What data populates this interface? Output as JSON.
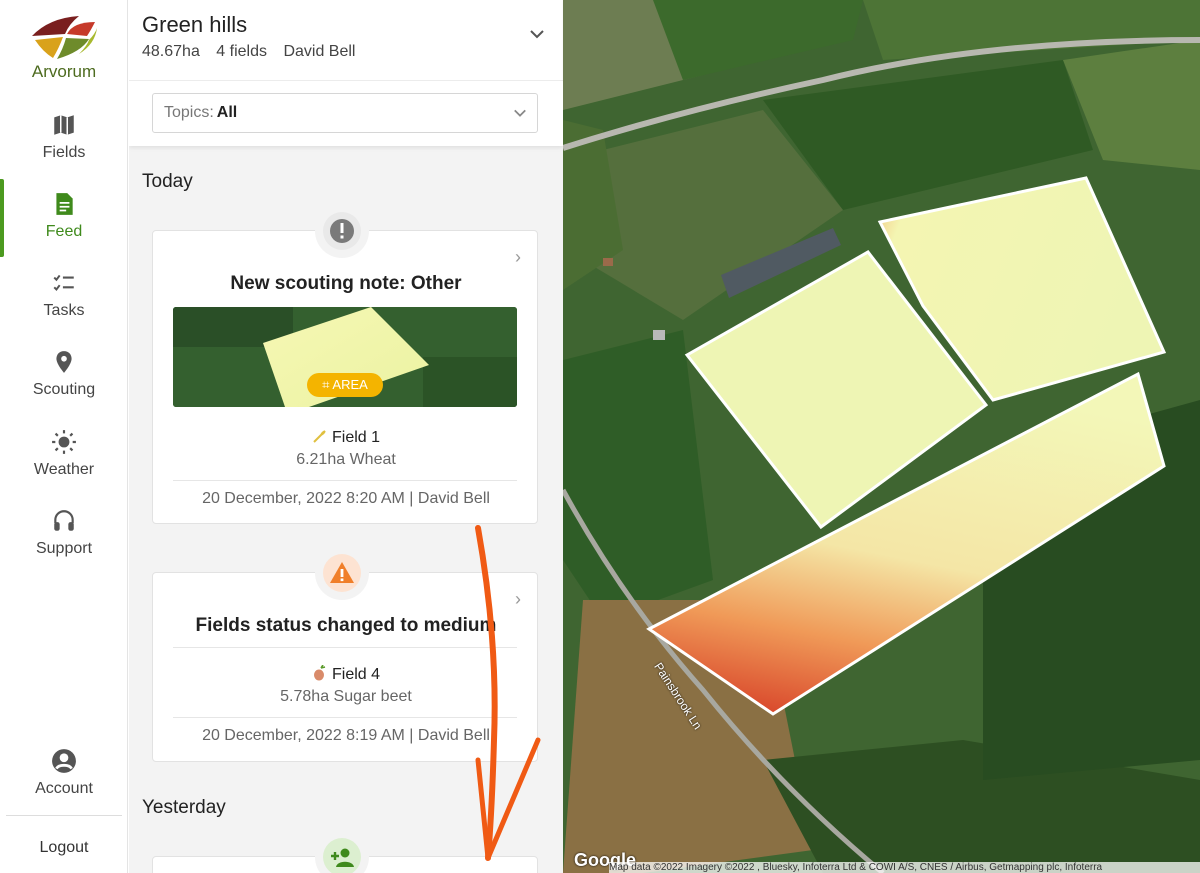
{
  "app": {
    "logo_text": "Arvorum"
  },
  "nav": {
    "fields": "Fields",
    "feed": "Feed",
    "tasks": "Tasks",
    "scouting": "Scouting",
    "weather": "Weather",
    "support": "Support",
    "account": "Account",
    "logout": "Logout"
  },
  "farm": {
    "name": "Green hills",
    "area": "48.67ha",
    "fields_count": "4 fields",
    "owner": "David Bell"
  },
  "topics": {
    "label": "Topics:",
    "value": "All"
  },
  "feed": {
    "today_label": "Today",
    "yesterday_label": "Yesterday",
    "cards": [
      {
        "title": "New scouting note: Other",
        "area_badge": "AREA",
        "field": "Field 1",
        "field_info": "6.21ha Wheat",
        "footer": "20 December, 2022 8:20 AM | David Bell"
      },
      {
        "title": "Fields status changed to medium",
        "field": "Field 4",
        "field_info": "5.78ha Sugar beet",
        "footer": "20 December, 2022 8:19 AM | David Bell"
      }
    ]
  },
  "map": {
    "google": "Google",
    "attribution": "Map data ©2022 Imagery ©2022 , Bluesky, Infoterra Ltd & COWI A/S, CNES / Airbus, Getmapping plc, Infoterra",
    "road_label": "Painsbrook Ln"
  },
  "colors": {
    "accent": "#4c9a1f",
    "warning": "#f07f2a",
    "area_badge": "#f4b400"
  }
}
